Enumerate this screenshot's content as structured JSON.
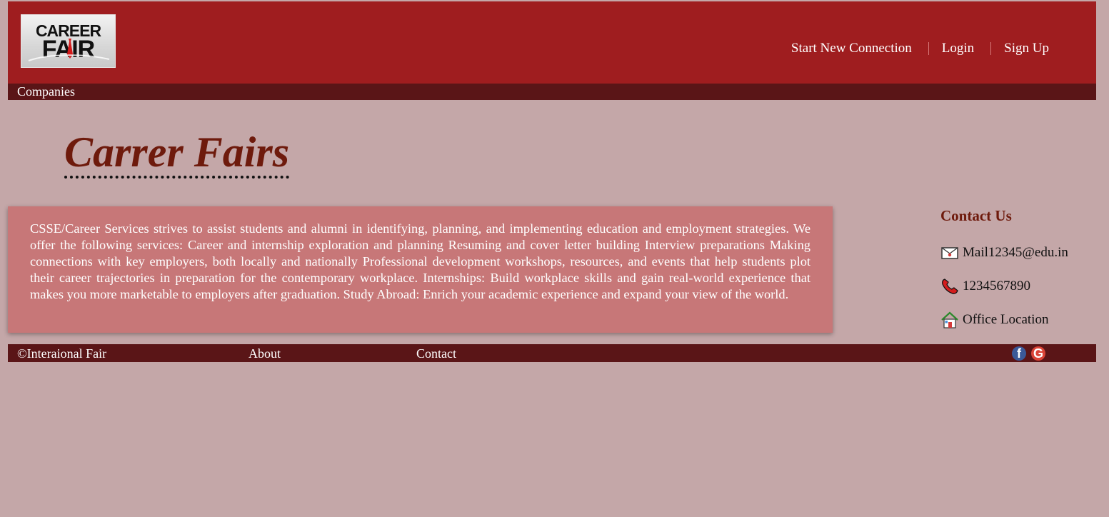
{
  "header": {
    "logo": {
      "line1": "CAREER",
      "line2": "FAIR"
    },
    "nav": [
      {
        "label": "Start New Connection"
      },
      {
        "label": "Login"
      },
      {
        "label": "Sign Up"
      }
    ]
  },
  "subnav": {
    "items": [
      {
        "label": "Companies"
      }
    ]
  },
  "main": {
    "title": "Carrer Fairs",
    "description": "CSSE/Career Services strives to assist students and alumni in identifying, planning, and implementing education and employment strategies. We offer the following services: Career and internship exploration and planning Resuming and cover letter building Interview preparations Making connections with key employers, both locally and nationally Professional development workshops, resources, and events that help students plot their career trajectories in preparation for the contemporary workplace. Internships: Build workplace skills and gain real-world experience that makes you more marketable to employers after graduation. Study Abroad: Enrich your academic experience and expand your view of the world."
  },
  "contact": {
    "heading": "Contact Us",
    "items": [
      {
        "icon": "mail-icon",
        "text": "Mail12345@edu.in"
      },
      {
        "icon": "phone-icon",
        "text": "1234567890"
      },
      {
        "icon": "home-icon",
        "text": "Office Location"
      }
    ]
  },
  "footer": {
    "copyright": "©Interaional Fair",
    "about": "About",
    "contact": "Contact",
    "social": [
      {
        "icon": "facebook-icon",
        "glyph": "f",
        "color": "#3b5998"
      },
      {
        "icon": "google-icon",
        "glyph": "G",
        "color": "#db4437"
      }
    ]
  },
  "colors": {
    "page_bg": "#c4a7a8",
    "header_bg": "#9f1d1f",
    "bar_bg": "#5a1517",
    "box_bg": "#c77778",
    "title": "#6e1a0c"
  }
}
